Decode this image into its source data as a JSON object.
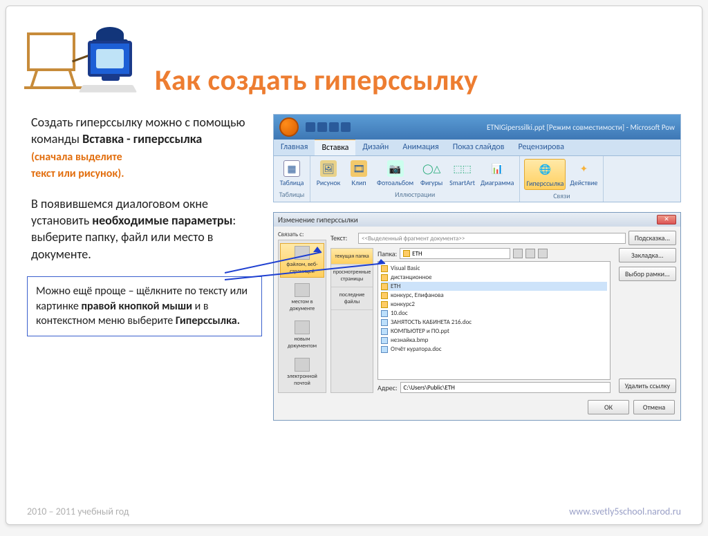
{
  "title": "Как создать гиперссылку",
  "para1_lead": "Создать гиперссылку можно с помощью команды ",
  "para1_bold": "Вставка - гиперссылка",
  "para1_note1": "(сначала выделите",
  "para1_note2": "текст или рисунок).",
  "para2_lead": "В появившемся диалоговом окне установить ",
  "para2_bold": "необходимые параметры",
  "para2_tail": ": выберите папку, файл или место в документе.",
  "tip_a": "Можно ещё проще – щёлкните по тексту или картинке ",
  "tip_b": "правой кнопкой мыши",
  "tip_c": " и в контекстном меню выберите ",
  "tip_d": "Гиперссылка.",
  "ribbon": {
    "window_title": "ETNIGiperssilki.ppt [Режим совместимости] - Microsoft Pow",
    "tabs": [
      "Главная",
      "Вставка",
      "Дизайн",
      "Анимация",
      "Показ слайдов",
      "Рецензирова"
    ],
    "group_tables": "Таблицы",
    "group_illus": "Иллюстрации",
    "group_links": "Связи",
    "btn_table": "Таблица",
    "btn_pic": "Рисунок",
    "btn_clip": "Клип",
    "btn_album": "Фотоальбом",
    "btn_shapes": "Фигуры",
    "btn_smart": "SmartArt",
    "btn_chart": "Диаграмма",
    "btn_hyper": "Гиперссылка",
    "btn_action": "Действие"
  },
  "dialog": {
    "title": "Изменение гиперссылки",
    "link_label": "Связать с:",
    "text_label": "Текст:",
    "text_value": "<<Выделенный фрагмент документа>>",
    "folder_label": "Папка:",
    "folder_value": "ETH",
    "address_label": "Адрес:",
    "address_value": "C:\\Users\\Public\\ETH",
    "linkto": [
      {
        "label": "файлом, веб-страницей",
        "sel": true
      },
      {
        "label": "местом в документе",
        "sel": false
      },
      {
        "label": "новым документом",
        "sel": false
      },
      {
        "label": "электронной почтой",
        "sel": false
      }
    ],
    "lookin": [
      {
        "label": "текущая папка",
        "sel": true
      },
      {
        "label": "просмотренные страницы",
        "sel": false
      },
      {
        "label": "последние файлы",
        "sel": false
      }
    ],
    "files": [
      {
        "name": "Visual Basic",
        "type": "folder",
        "sel": false
      },
      {
        "name": "дистанционное",
        "type": "folder",
        "sel": false
      },
      {
        "name": "ETH",
        "type": "folder",
        "sel": true
      },
      {
        "name": "конкурс, Епифанова",
        "type": "folder",
        "sel": false
      },
      {
        "name": "конкурс2",
        "type": "folder",
        "sel": false
      },
      {
        "name": "10.doc",
        "type": "doc",
        "sel": false
      },
      {
        "name": "ЗАНЯТОСТЬ КАБИНЕТА   216.doc",
        "type": "doc",
        "sel": false
      },
      {
        "name": "КОМПЬЮТЕР и ПО.ppt",
        "type": "doc",
        "sel": false
      },
      {
        "name": "незнайка.bmp",
        "type": "doc",
        "sel": false
      },
      {
        "name": "Отчёт куратора.doc",
        "type": "doc",
        "sel": false
      }
    ],
    "btn_tip": "Подсказка...",
    "btn_bookmark": "Закладка...",
    "btn_frame": "Выбор рамки...",
    "btn_remove": "Удалить ссылку",
    "btn_ok": "ОК",
    "btn_cancel": "Отмена"
  },
  "footer": {
    "year": "2010 – 2011 учебный год",
    "url": "www.svetly5school.narod.ru"
  }
}
